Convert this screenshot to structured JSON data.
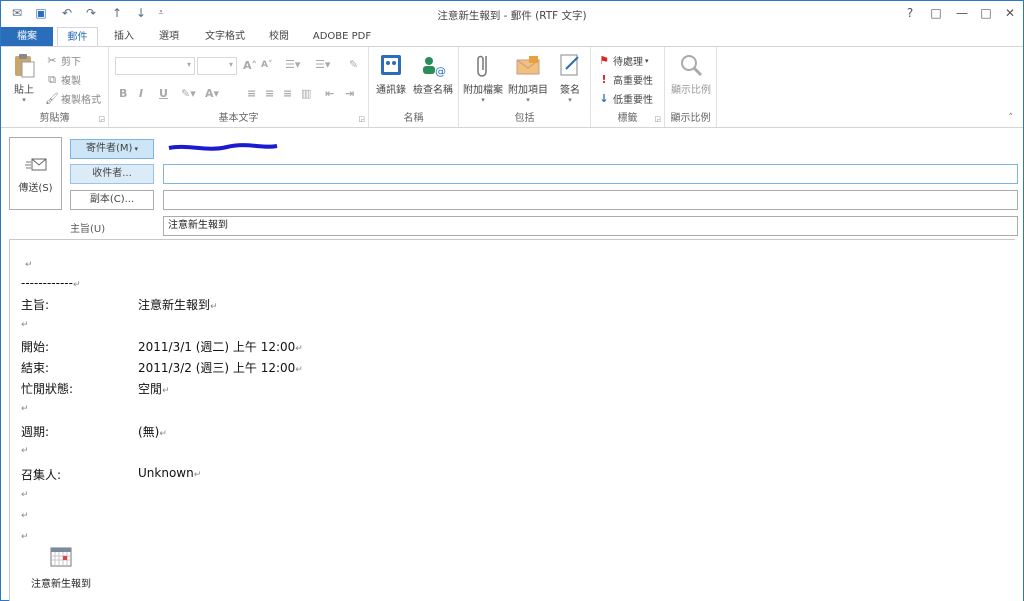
{
  "window": {
    "title": "注意新生報到 - 郵件 (RTF 文字)",
    "controls": [
      "?",
      "□",
      "—",
      "□",
      "✕"
    ]
  },
  "tabs": [
    {
      "label": "檔案",
      "active": false
    },
    {
      "label": "郵件",
      "active": true
    },
    {
      "label": "插入",
      "active": false
    },
    {
      "label": "選項",
      "active": false
    },
    {
      "label": "文字格式",
      "active": false
    },
    {
      "label": "校閱",
      "active": false
    },
    {
      "label": "ADOBE PDF",
      "active": false
    }
  ],
  "ribbon": {
    "clipboard": {
      "label": "剪貼簿",
      "paste": "貼上",
      "cut": "剪下",
      "copy": "複製",
      "format_painter": "複製格式"
    },
    "basic_text": {
      "label": "基本文字"
    },
    "names": {
      "label": "名稱",
      "address_book": "通訊錄",
      "check_names": "檢查名稱"
    },
    "include": {
      "label": "包括",
      "attach_file": "附加檔案",
      "attach_item": "附加項目",
      "signature": "簽名"
    },
    "tags": {
      "label": "標籤",
      "follow_up": "待處理",
      "high_importance": "高重要性",
      "low_importance": "低重要性"
    },
    "zoom": {
      "label": "顯示比例",
      "zoom": "顯示比例"
    }
  },
  "header": {
    "send": "傳送(S)",
    "from_button": "寄件者(M)",
    "to_button": "收件者...",
    "cc_button": "副本(C)...",
    "subject_label": "主旨(U)",
    "to_value": "",
    "cc_value": "",
    "subject_value": "注意新生報到"
  },
  "body": {
    "separator": "------------",
    "rows": [
      {
        "key": "主旨:",
        "value": "注意新生報到"
      },
      {
        "key": "開始:",
        "value": "2011/3/1 (週二) 上午 12:00"
      },
      {
        "key": "結束:",
        "value": "2011/3/2 (週三) 上午 12:00"
      },
      {
        "key": "忙閒狀態:",
        "value": "空閒"
      },
      {
        "key": "週期:",
        "value": "(無)"
      },
      {
        "key": "召集人:",
        "value": "Unknown"
      }
    ],
    "attachment_name": "注意新生報到",
    "paragraph_mark": "↵"
  }
}
